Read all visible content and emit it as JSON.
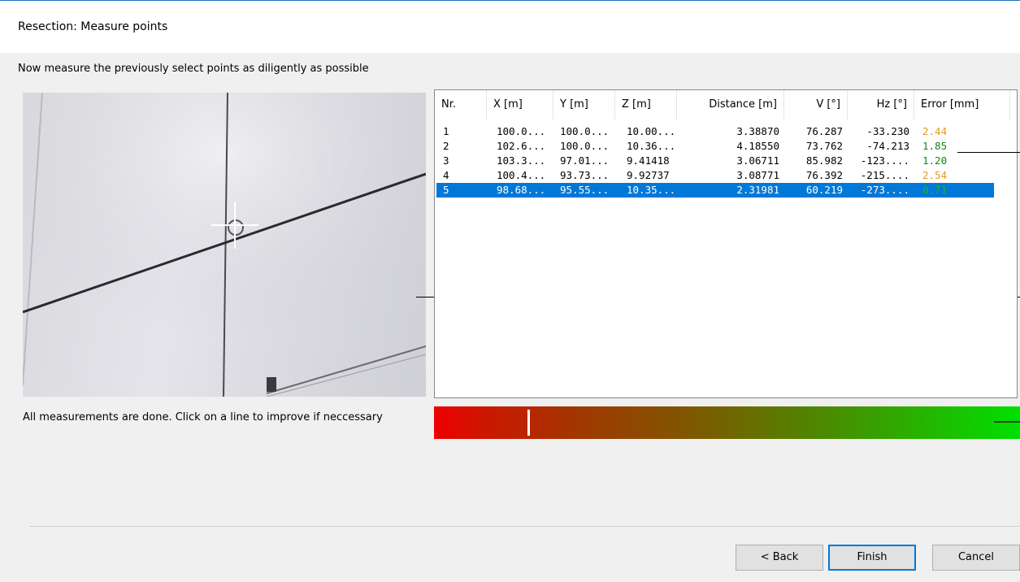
{
  "window": {
    "title": "Resection: Measure points"
  },
  "instruction": "Now measure the previously select points as diligently as possible",
  "table": {
    "columns": [
      "Nr.",
      "X [m]",
      "Y [m]",
      "Z [m]",
      "Distance [m]",
      "V [°]",
      "Hz [°]",
      "Error [mm]"
    ],
    "rows": [
      {
        "nr": "1",
        "x": "100.0...",
        "y": "100.0...",
        "z": "10.00...",
        "distance": "3.38870",
        "v": "76.287",
        "hz": "-33.230",
        "error": "2.44",
        "error_status": "warn",
        "selected": false
      },
      {
        "nr": "2",
        "x": "102.6...",
        "y": "100.0...",
        "z": "10.36...",
        "distance": "4.18550",
        "v": "73.762",
        "hz": "-74.213",
        "error": "1.85",
        "error_status": "good",
        "selected": false
      },
      {
        "nr": "3",
        "x": "103.3...",
        "y": "97.01...",
        "z": "9.41418",
        "distance": "3.06711",
        "v": "85.982",
        "hz": "-123....",
        "error": "1.20",
        "error_status": "good",
        "selected": false
      },
      {
        "nr": "4",
        "x": "100.4...",
        "y": "93.73...",
        "z": "9.92737",
        "distance": "3.08771",
        "v": "76.392",
        "hz": "-215....",
        "error": "2.54",
        "error_status": "warn",
        "selected": false
      },
      {
        "nr": "5",
        "x": "98.68...",
        "y": "95.55...",
        "z": "10.35...",
        "distance": "2.31981",
        "v": "60.219",
        "hz": "-273....",
        "error": "0.71",
        "error_status": "good",
        "selected": true
      }
    ]
  },
  "status": "All measurements are done. Click on a line to improve if neccessary",
  "quality": {
    "marker_fraction": 0.16
  },
  "buttons": {
    "back": "< Back",
    "finish": "Finish",
    "cancel": "Cancel"
  },
  "colors": {
    "accent": "#0078d7",
    "error_good": "#0f8a0f",
    "error_warn": "#e39a1a"
  }
}
